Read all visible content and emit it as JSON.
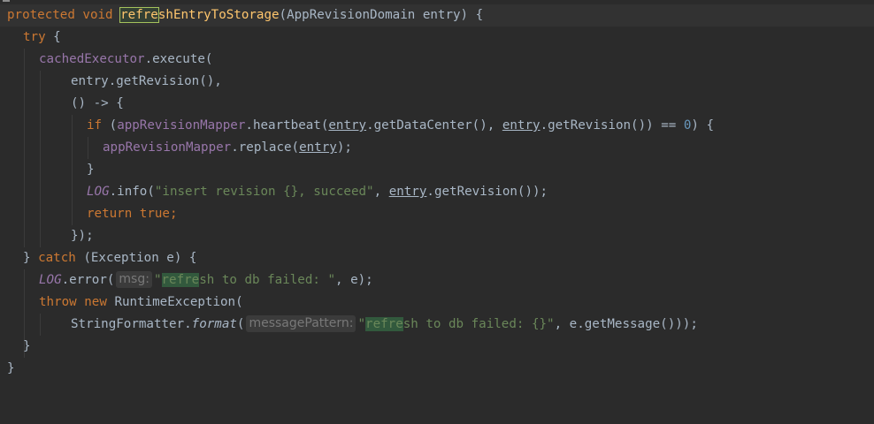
{
  "code": {
    "l1": {
      "kw_protected": "protected",
      "kw_void": "void",
      "method_hl": "refre",
      "method_rest": "shEntryToStorage",
      "params": "(AppRevisionDomain entry) {"
    },
    "l2": {
      "kw_try": "try",
      "brace": " {"
    },
    "l3": {
      "field": "cachedExecutor",
      "rest": ".execute("
    },
    "l4": {
      "text": "entry.getRevision(),"
    },
    "l5": {
      "text": "() -> {"
    },
    "l6": {
      "kw_if": "if",
      "open": " (",
      "field": "appRevisionMapper",
      "call": ".heartbeat(",
      "arg1": "entry",
      "mid1": ".getDataCenter(), ",
      "arg2": "entry",
      "mid2": ".getRevision()) == ",
      "zero": "0",
      "close": ") {"
    },
    "l7": {
      "field": "appRevisionMapper",
      "call": ".replace(",
      "arg": "entry",
      "close": ");"
    },
    "l8": {
      "text": "}"
    },
    "l9": {
      "log": "LOG",
      "call": ".info(",
      "str": "\"insert revision {}, succeed\"",
      "sep": ", ",
      "arg": "entry",
      "rest": ".getRevision());"
    },
    "l10": {
      "kw_return": "return",
      "kw_true": "true",
      "semi": ";"
    },
    "l11": {
      "text": "});"
    },
    "l12": {
      "brace": "} ",
      "kw_catch": "catch",
      "rest": " (Exception e) {"
    },
    "l13": {
      "log": "LOG",
      "call": ".error(",
      "hint": "msg:",
      "str_quote": "\"",
      "str_hl": "refre",
      "str_rest": "sh to db failed: \"",
      "rest": ", e);"
    },
    "l14": {
      "kw_throw": "throw",
      "kw_new": "new",
      "rest": "RuntimeException("
    },
    "l15": {
      "cls": "StringFormatter.",
      "method": "format",
      "paren": "(",
      "hint": "messagePattern:",
      "str_quote": "\"",
      "str_hl": "refre",
      "str_rest": "sh to db failed: {}\"",
      "rest": ", e.getMessage()));"
    },
    "l16": {
      "text": "}"
    },
    "l17": {
      "text": "}"
    }
  },
  "colors": {
    "background": "#2b2b2b",
    "current_line": "#323232",
    "keyword": "#cc7832",
    "method_declaration": "#ffc66d",
    "field": "#9876aa",
    "string": "#6a8759",
    "number": "#6897bb",
    "default_text": "#a9b7c6",
    "search_highlight": "#32593d",
    "parameter_hint": "#787878"
  }
}
